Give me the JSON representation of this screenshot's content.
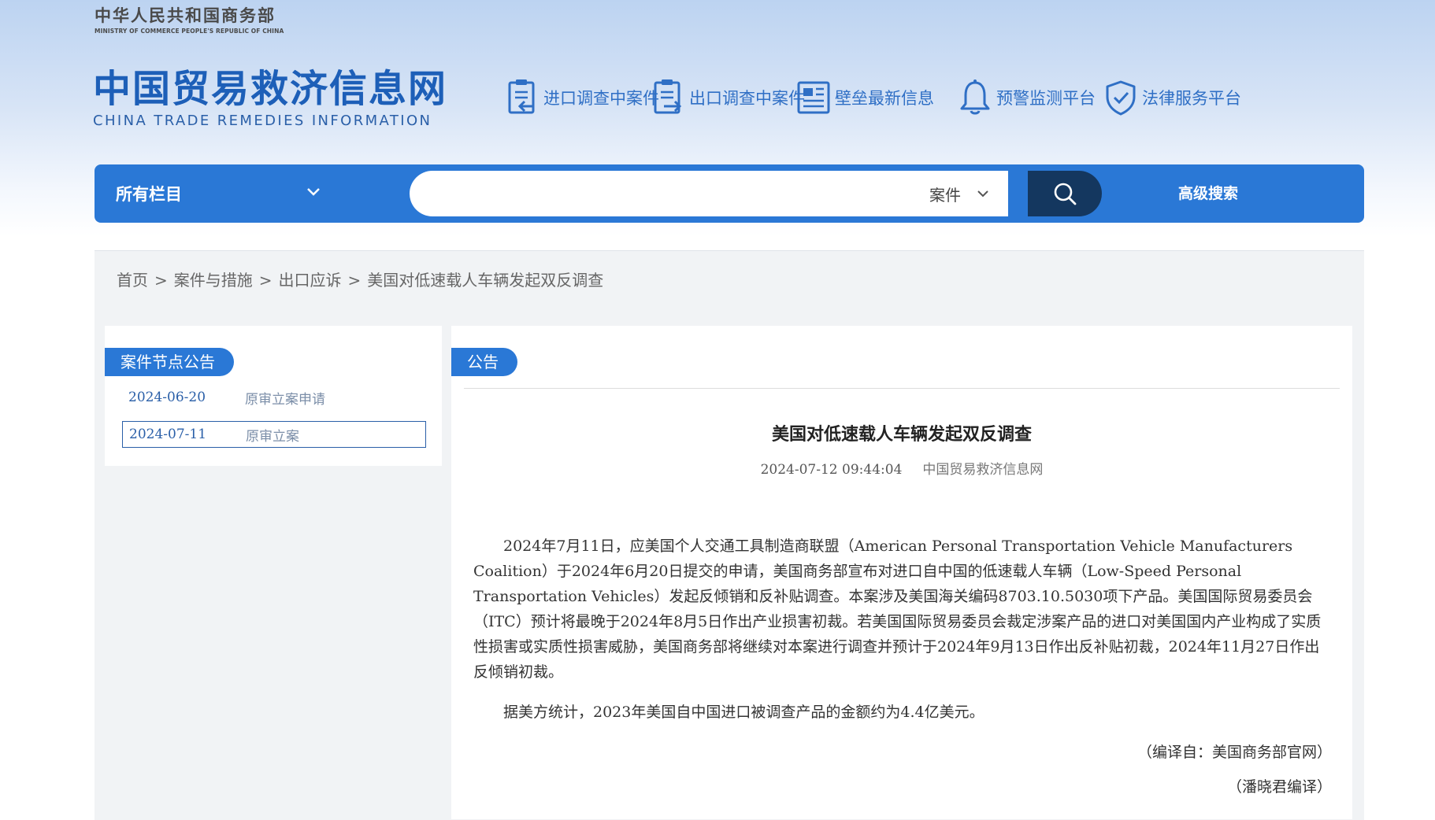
{
  "header": {
    "ministry_cn": "中华人民共和国商务部",
    "ministry_en": "MINISTRY OF COMMERCE PEOPLE'S REPUBLIC OF CHINA",
    "site_cn": "中国贸易救济信息网",
    "site_en": "CHINA TRADE REMEDIES INFORMATION"
  },
  "topnav": {
    "items": [
      {
        "label": "进口调查中案件",
        "icon": "import-case-icon"
      },
      {
        "label": "出口调查中案件",
        "icon": "export-case-icon"
      },
      {
        "label": "壁垒最新信息",
        "icon": "news-icon"
      },
      {
        "label": "预警监测平台",
        "icon": "bell-icon"
      },
      {
        "label": "法律服务平台",
        "icon": "shield-check-icon"
      }
    ]
  },
  "search": {
    "scope_label": "所有栏目",
    "query": "",
    "type_label": "案件",
    "advanced_label": "高级搜索",
    "button_icon": "search-icon"
  },
  "breadcrumb": {
    "home": "首页",
    "sep1": ">",
    "level1": "案件与措施",
    "sep2": ">",
    "level2": "出口应诉",
    "sep3": ">",
    "current": "美国对低速载人车辆发起双反调查"
  },
  "sidebar": {
    "tab_label": "案件节点公告",
    "nodes": [
      {
        "date": "2024-06-20",
        "name": "原审立案申请"
      },
      {
        "date": "2024-07-11",
        "name": "原审立案"
      }
    ]
  },
  "article": {
    "tab_label": "公告",
    "title": "美国对低速载人车辆发起双反调查",
    "datetime": "2024-07-12 09:44:04",
    "source": "中国贸易救济信息网",
    "paragraphs": [
      "2024年7月11日，应美国个人交通工具制造商联盟（American Personal Transportation Vehicle Manufacturers Coalition）于2024年6月20日提交的申请，美国商务部宣布对进口自中国的低速载人车辆（Low-Speed Personal Transportation Vehicles）发起反倾销和反补贴调查。本案涉及美国海关编码8703.10.5030项下产品。美国国际贸易委员会（ITC）预计将最晚于2024年8月5日作出产业损害初裁。若美国国际贸易委员会裁定涉案产品的进口对美国国内产业构成了实质性损害或实质性损害威胁，美国商务部将继续对本案进行调查并预计于2024年9月13日作出反补贴初裁，2024年11月27日作出反倾销初裁。",
      "据美方统计，2023年美国自中国进口被调查产品的金额约为4.4亿美元。"
    ],
    "credit_source": "（编译自：美国商务部官网）",
    "credit_editor": "（潘晓君编译）"
  }
}
